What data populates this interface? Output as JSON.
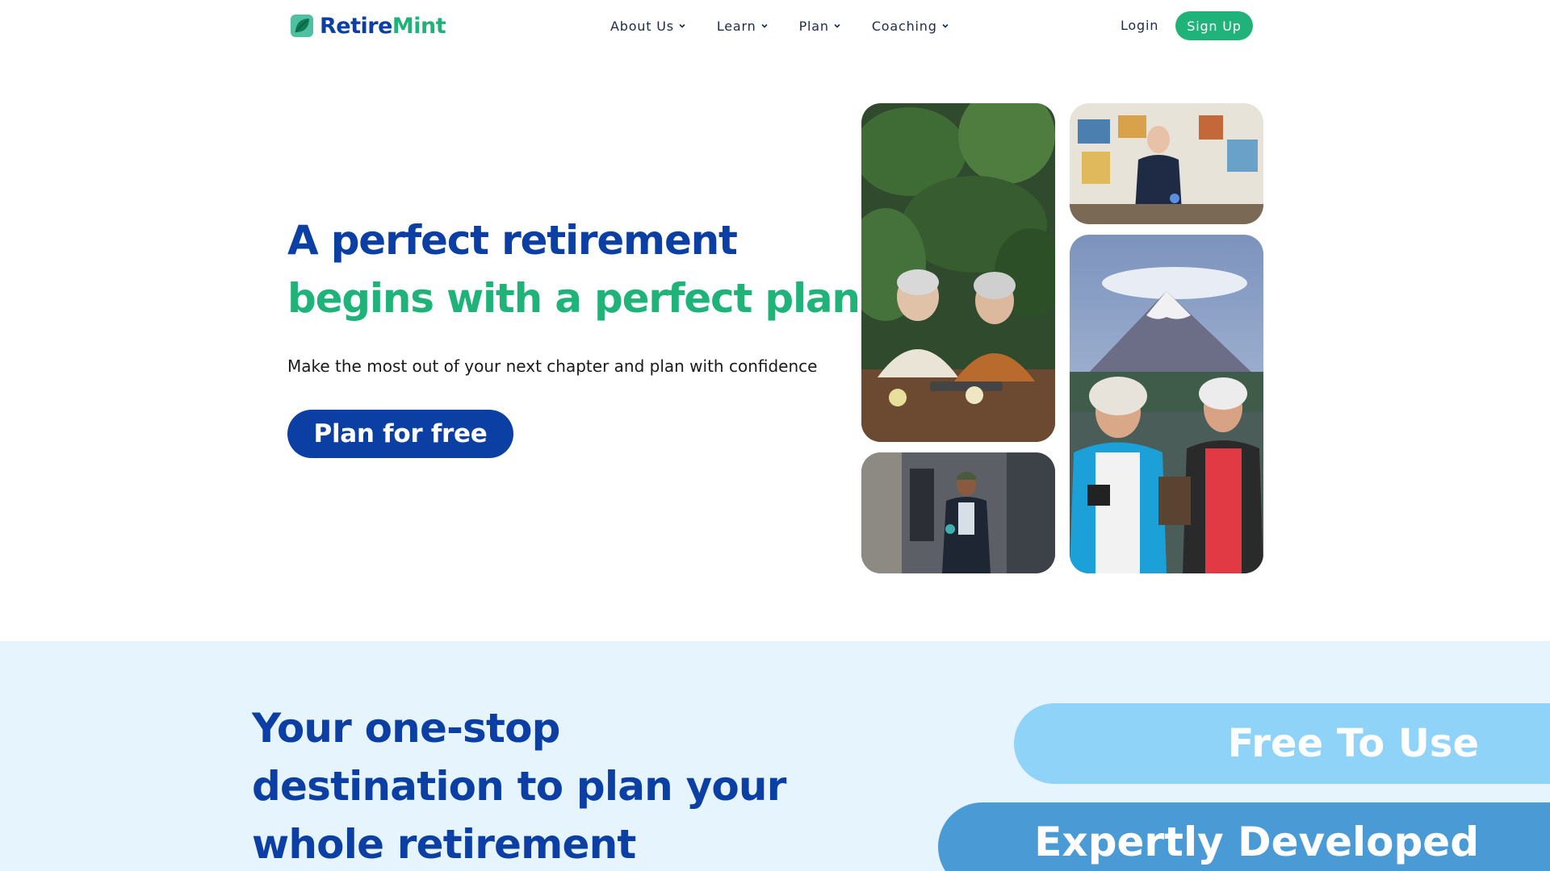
{
  "brand": {
    "part1": "Retire",
    "part2": "Mint"
  },
  "nav": {
    "items": [
      {
        "label": "About Us"
      },
      {
        "label": "Learn"
      },
      {
        "label": "Plan"
      },
      {
        "label": "Coaching"
      }
    ],
    "login": "Login",
    "signup": "Sign Up"
  },
  "hero": {
    "title_line1": "A perfect retirement",
    "title_line2": "begins with a perfect plan",
    "subtitle": "Make the most out of your next chapter and plan with confidence",
    "cta": "Plan for free"
  },
  "photos": [
    {
      "name": "couple-with-coffee-photo"
    },
    {
      "name": "man-painting-studio-photo"
    },
    {
      "name": "two-men-mountain-lake-photo"
    },
    {
      "name": "man-walking-city-photo"
    }
  ],
  "features": {
    "title_lines": [
      "Your one-stop",
      "destination to plan your",
      "whole retirement"
    ],
    "pills": [
      "Free To Use",
      "Expertly Developed"
    ]
  },
  "colors": {
    "brand_blue": "#0b3fa3",
    "brand_green": "#1fb37a",
    "section_bg": "#e6f4fd",
    "pill_light": "#8fd3f8",
    "pill_mid": "#4a9ad6"
  }
}
